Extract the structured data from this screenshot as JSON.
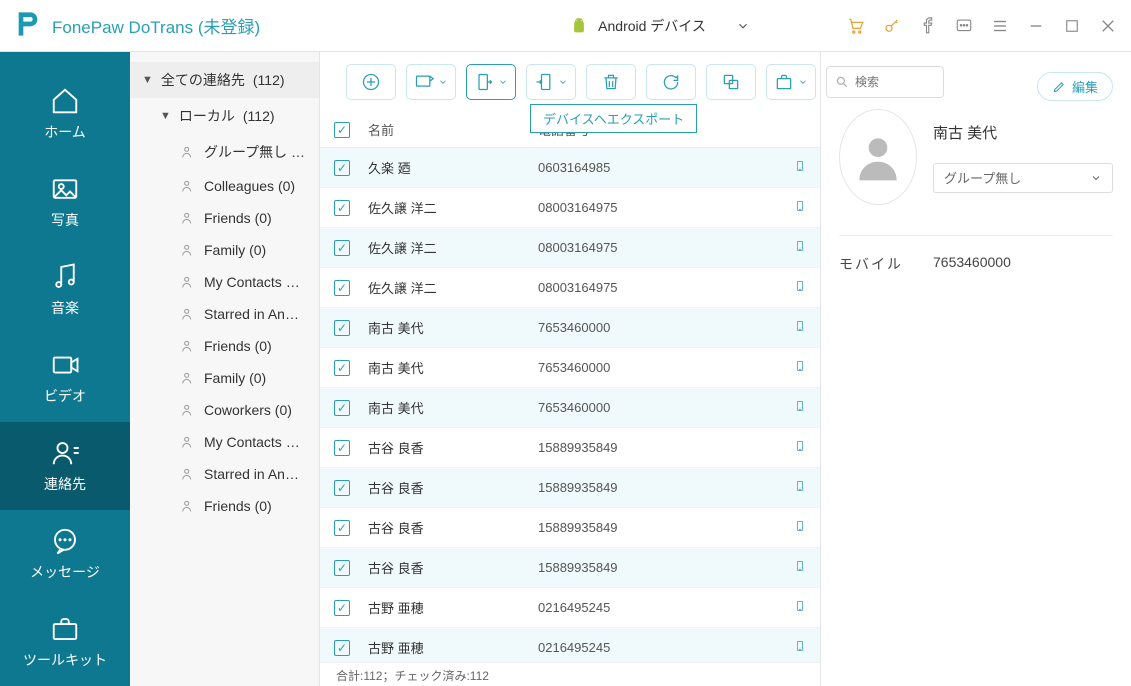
{
  "header": {
    "app_title": "FonePaw DoTrans (未登録)",
    "device_label": "Android デバイス"
  },
  "nav": {
    "home": "ホーム",
    "photos": "写真",
    "music": "音楽",
    "videos": "ビデオ",
    "contacts": "連絡先",
    "messages": "メッセージ",
    "toolkit": "ツールキット"
  },
  "groups": {
    "all_label": "全ての連絡先",
    "all_count": "(112)",
    "local_label": "ローカル",
    "local_count": "(112)",
    "items": [
      {
        "label": "グループ無し  …"
      },
      {
        "label": "Colleagues  (0)"
      },
      {
        "label": "Friends  (0)"
      },
      {
        "label": "Family  (0)"
      },
      {
        "label": "My Contacts  …"
      },
      {
        "label": "Starred in An…"
      },
      {
        "label": "Friends  (0)"
      },
      {
        "label": "Family  (0)"
      },
      {
        "label": "Coworkers  (0)"
      },
      {
        "label": "My Contacts  …"
      },
      {
        "label": "Starred in An…"
      },
      {
        "label": "Friends  (0)"
      }
    ]
  },
  "toolbar": {
    "tooltip": "デバイスヘエクスポート",
    "search_placeholder": "検索"
  },
  "table": {
    "header_name": "名前",
    "header_phone": "電話番号",
    "rows": [
      {
        "name": "久楽 廼",
        "phone": "0603164985"
      },
      {
        "name": "佐久譲 洋二",
        "phone": "08003164975"
      },
      {
        "name": "佐久譲 洋二",
        "phone": "08003164975"
      },
      {
        "name": "佐久譲 洋二",
        "phone": "08003164975"
      },
      {
        "name": "南古 美代",
        "phone": "7653460000"
      },
      {
        "name": "南古 美代",
        "phone": "7653460000"
      },
      {
        "name": "南古 美代",
        "phone": "7653460000"
      },
      {
        "name": "古谷 良香",
        "phone": "15889935849"
      },
      {
        "name": "古谷 良香",
        "phone": "15889935849"
      },
      {
        "name": "古谷 良香",
        "phone": "15889935849"
      },
      {
        "name": "古谷 良香",
        "phone": "15889935849"
      },
      {
        "name": "古野 亜穂",
        "phone": "0216495245"
      },
      {
        "name": "古野 亜穂",
        "phone": "0216495245"
      }
    ],
    "status": "合計:112；チェック済み:112"
  },
  "detail": {
    "edit_label": "編集",
    "name": "南古 美代",
    "group_value": "グループ無し",
    "phone_label": "モバイル",
    "phone_value": "7653460000"
  }
}
